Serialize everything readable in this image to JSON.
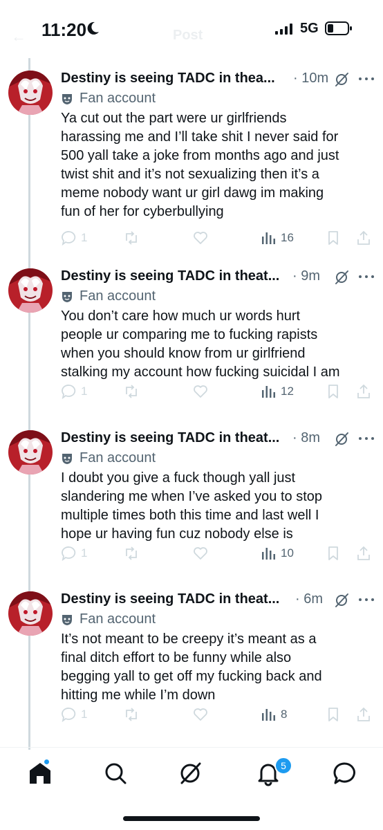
{
  "status_bar": {
    "time": "11:20",
    "network": "5G",
    "icons": [
      "moon-icon",
      "signal-icon",
      "battery-icon"
    ]
  },
  "header": {
    "title": "Post",
    "back_icon": "back-arrow-icon"
  },
  "colors": {
    "accent": "#1d9bf0",
    "text": "#0f1419",
    "secondary": "#536471",
    "faded": "#cfd9de",
    "avatar_red": "#b8202a"
  },
  "posts": [
    {
      "author": "Destiny is seeing TADC in thea...",
      "time": "· 10m",
      "label": "Fan account",
      "lines": [
        "Ya cut out the part were ur girlfriends",
        "harassing me and I’ll take shit I never said for",
        "500 yall take a joke from months ago and just",
        "twist shit and it’s not sexualizing then it’s a",
        "meme nobody want ur girl dawg im making",
        "fun of her for cyberbullying"
      ],
      "replies": "1",
      "views": "16"
    },
    {
      "author": "Destiny is seeing TADC in theat...",
      "time": "· 9m",
      "label": "Fan account",
      "lines": [
        "You don’t care how much ur words hurt",
        "people ur comparing me to fucking rapists",
        "when you should know from ur girlfriend",
        "stalking my account how fucking suicidal I am"
      ],
      "replies": "1",
      "views": "12"
    },
    {
      "author": "Destiny is seeing TADC in theat...",
      "time": "· 8m",
      "label": "Fan account",
      "lines": [
        "I doubt you give a fuck though yall just",
        "slandering me when I’ve asked you to stop",
        "multiple times both this time and last well I",
        "hope ur having fun cuz nobody else is"
      ],
      "replies": "1",
      "views": "10"
    },
    {
      "author": "Destiny is seeing TADC in theat...",
      "time": "· 6m",
      "label": "Fan account",
      "lines": [
        "It’s not meant to be creepy it’s meant as a",
        "final ditch effort to be funny while also",
        "begging yall to get off my fucking back and",
        "hitting me while I’m down"
      ],
      "replies": "1",
      "views": "8"
    }
  ],
  "tabbar": {
    "tabs": [
      "home-icon",
      "search-icon",
      "grok-icon",
      "notifications-icon",
      "messages-icon"
    ],
    "notification_badge": "5"
  }
}
